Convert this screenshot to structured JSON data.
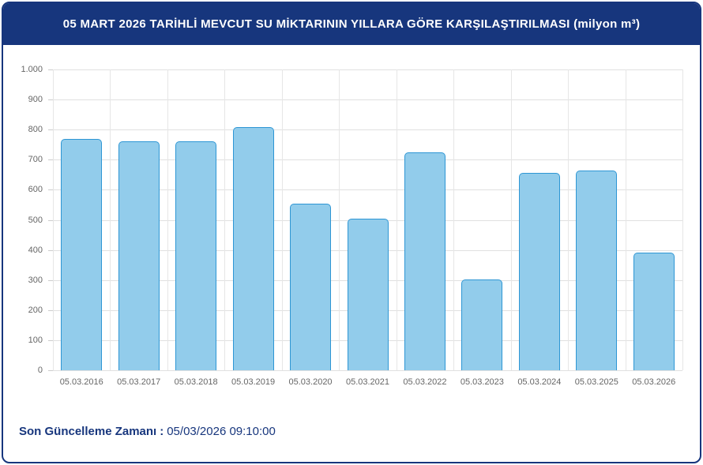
{
  "header": {
    "title": "05 MART 2026 TARİHLİ MEVCUT SU MİKTARININ YILLARA GÖRE KARŞILAŞTIRILMASI (milyon m³)"
  },
  "footer": {
    "label": "Son Güncelleme Zamanı",
    "separator": ":",
    "value": "05/03/2026 09:10:00"
  },
  "colors": {
    "banner_navy": "#17367D",
    "bar_fill": "#92CCEB",
    "bar_border": "#2E96D4",
    "gridline": "#E0E0E0",
    "axis_text": "#666666"
  },
  "chart_data": {
    "type": "bar",
    "title": "05 MART 2026 TARİHLİ MEVCUT SU MİKTARININ YILLARA GÖRE KARŞILAŞTIRILMASI (milyon m³)",
    "xlabel": "",
    "ylabel": "",
    "categories": [
      "05.03.2016",
      "05.03.2017",
      "05.03.2018",
      "05.03.2019",
      "05.03.2020",
      "05.03.2021",
      "05.03.2022",
      "05.03.2023",
      "05.03.2024",
      "05.03.2025",
      "05.03.2026"
    ],
    "values": [
      770,
      762,
      760,
      808,
      554,
      503,
      724,
      302,
      657,
      665,
      391
    ],
    "ylim": [
      0,
      1000
    ],
    "ytick_step": 100,
    "ytick_labels": [
      "0",
      "100",
      "200",
      "300",
      "400",
      "500",
      "600",
      "700",
      "800",
      "900",
      "1.000"
    ],
    "grid": true,
    "legend": false
  }
}
